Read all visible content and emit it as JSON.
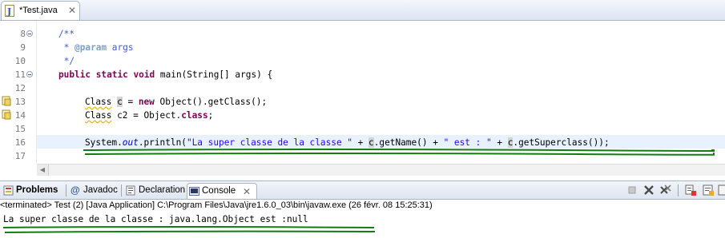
{
  "editor": {
    "tab_title": "*Test.java",
    "lines": [
      {
        "num": "8",
        "fold": true,
        "marker": false
      },
      {
        "num": "9",
        "fold": false,
        "marker": false
      },
      {
        "num": "10",
        "fold": false,
        "marker": false
      },
      {
        "num": "11",
        "fold": true,
        "marker": false
      },
      {
        "num": "12",
        "fold": false,
        "marker": false
      },
      {
        "num": "13",
        "fold": false,
        "marker": true
      },
      {
        "num": "14",
        "fold": false,
        "marker": true
      },
      {
        "num": "15",
        "fold": false,
        "marker": false
      },
      {
        "num": "16",
        "fold": false,
        "marker": false
      },
      {
        "num": "17",
        "fold": false,
        "marker": false
      }
    ],
    "code": {
      "l8": "/**",
      "l9_star": " * ",
      "l9_tag": "@param",
      "l9_text": " args",
      "l10": " */",
      "l11_kw": "public static void",
      "l11_text": " main(String[] args) {",
      "l13_type": "Class",
      "l13_var": "c",
      "l13_eq": " = ",
      "l13_kw": "new",
      "l13_rest": " Object().getClass();",
      "l14_type": "Class",
      "l14_rest": " c2 = Object.",
      "l14_kw": "class",
      "l14_end": ";",
      "l16_a": "System.",
      "l16_out": "out",
      "l16_b": ".println(",
      "l16_str1": "\"La super classe de la classe \"",
      "l16_c": " + ",
      "l16_var1": "c",
      "l16_d": ".getName() + ",
      "l16_str2": "\" est : \"",
      "l16_e": " + ",
      "l16_var2": "c",
      "l16_f": ".getSuperclass());"
    }
  },
  "views": {
    "tabs": [
      {
        "label": "Problems",
        "bold": true
      },
      {
        "label": "Javadoc"
      },
      {
        "label": "Declaration"
      },
      {
        "label": "Console",
        "active": true
      }
    ]
  },
  "console": {
    "header": "<terminated> Test (2) [Java Application] C:\\Program Files\\Java\\jre1.6.0_03\\bin\\javaw.exe (26 févr. 08 15:25:31)",
    "output": "La super classe de la classe : java.lang.Object est :null"
  },
  "colors": {
    "keyword": "#7f0055",
    "comment": "#3f5fbf",
    "string": "#2a00ff",
    "annotation_underline": "#127d12",
    "current_line": "#e8f2fe"
  }
}
